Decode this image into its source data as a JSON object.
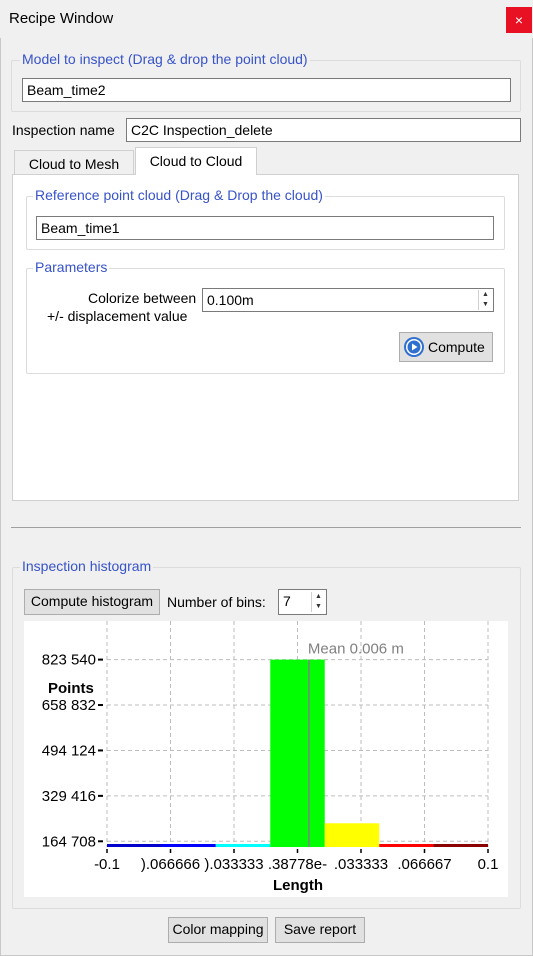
{
  "window": {
    "title": "Recipe Window",
    "close_glyph": "×"
  },
  "model_group": {
    "title": "Model to inspect (Drag & drop the point cloud)",
    "value": "Beam_time2"
  },
  "inspection_name": {
    "label": "Inspection name",
    "value": "C2C Inspection_delete"
  },
  "tabs": [
    {
      "label": "Cloud to Mesh",
      "active": false
    },
    {
      "label": "Cloud to Cloud",
      "active": true
    }
  ],
  "reference_group": {
    "title": "Reference point cloud (Drag & Drop the cloud)",
    "value": "Beam_time1"
  },
  "parameters_group": {
    "title": "Parameters",
    "colorize_label_line1": "Colorize between",
    "colorize_label_line2": "+/- displacement value",
    "colorize_value": "0.100m",
    "compute_label": "Compute"
  },
  "histogram_group": {
    "title": "Inspection histogram",
    "compute_histogram_label": "Compute histogram",
    "bins_label": "Number of bins:",
    "bins_value": "7"
  },
  "footer": {
    "color_mapping_label": "Color mapping",
    "save_report_label": "Save report"
  },
  "icons": {
    "compute": "play-circle-icon",
    "spin_up": "spin-up-icon",
    "spin_down": "spin-down-icon",
    "close": "close-icon"
  },
  "chart_data": {
    "type": "bar",
    "ylabel": "Points",
    "xlabel": "Length",
    "y_tick_labels": [
      "164 708",
      "329 416",
      "494 124",
      "658 832",
      "823 540"
    ],
    "y_ticks": [
      164708,
      329416,
      494124,
      658832,
      823540
    ],
    "x_tick_labels": [
      "-0.1",
      ").066666",
      ").033333",
      ".38778e-",
      ".033333",
      ".066667",
      "0.1"
    ],
    "x_ticks": [
      -0.1,
      -0.066666,
      -0.033333,
      0.0,
      0.033333,
      0.066667,
      0.1
    ],
    "bins": [
      {
        "x0": -0.1,
        "x1": -0.0714,
        "value": 3000,
        "color": "#0000cc"
      },
      {
        "x0": -0.0714,
        "x1": -0.0429,
        "value": 9000,
        "color": "#0000ff"
      },
      {
        "x0": -0.0429,
        "x1": -0.0143,
        "value": 30000,
        "color": "#00ffff"
      },
      {
        "x0": -0.0143,
        "x1": 0.0143,
        "value": 823540,
        "color": "#00ff00"
      },
      {
        "x0": 0.0143,
        "x1": 0.0429,
        "value": 230000,
        "color": "#ffff00"
      },
      {
        "x0": 0.0429,
        "x1": 0.0714,
        "value": 22000,
        "color": "#ff0000"
      },
      {
        "x0": 0.0714,
        "x1": 0.1,
        "value": 16000,
        "color": "#8b0000"
      }
    ],
    "mean": 0.006,
    "mean_label": "Mean 0.006 m",
    "xlim": [
      -0.1,
      0.1
    ],
    "ylim": [
      144000,
      920000
    ],
    "grid": true
  }
}
